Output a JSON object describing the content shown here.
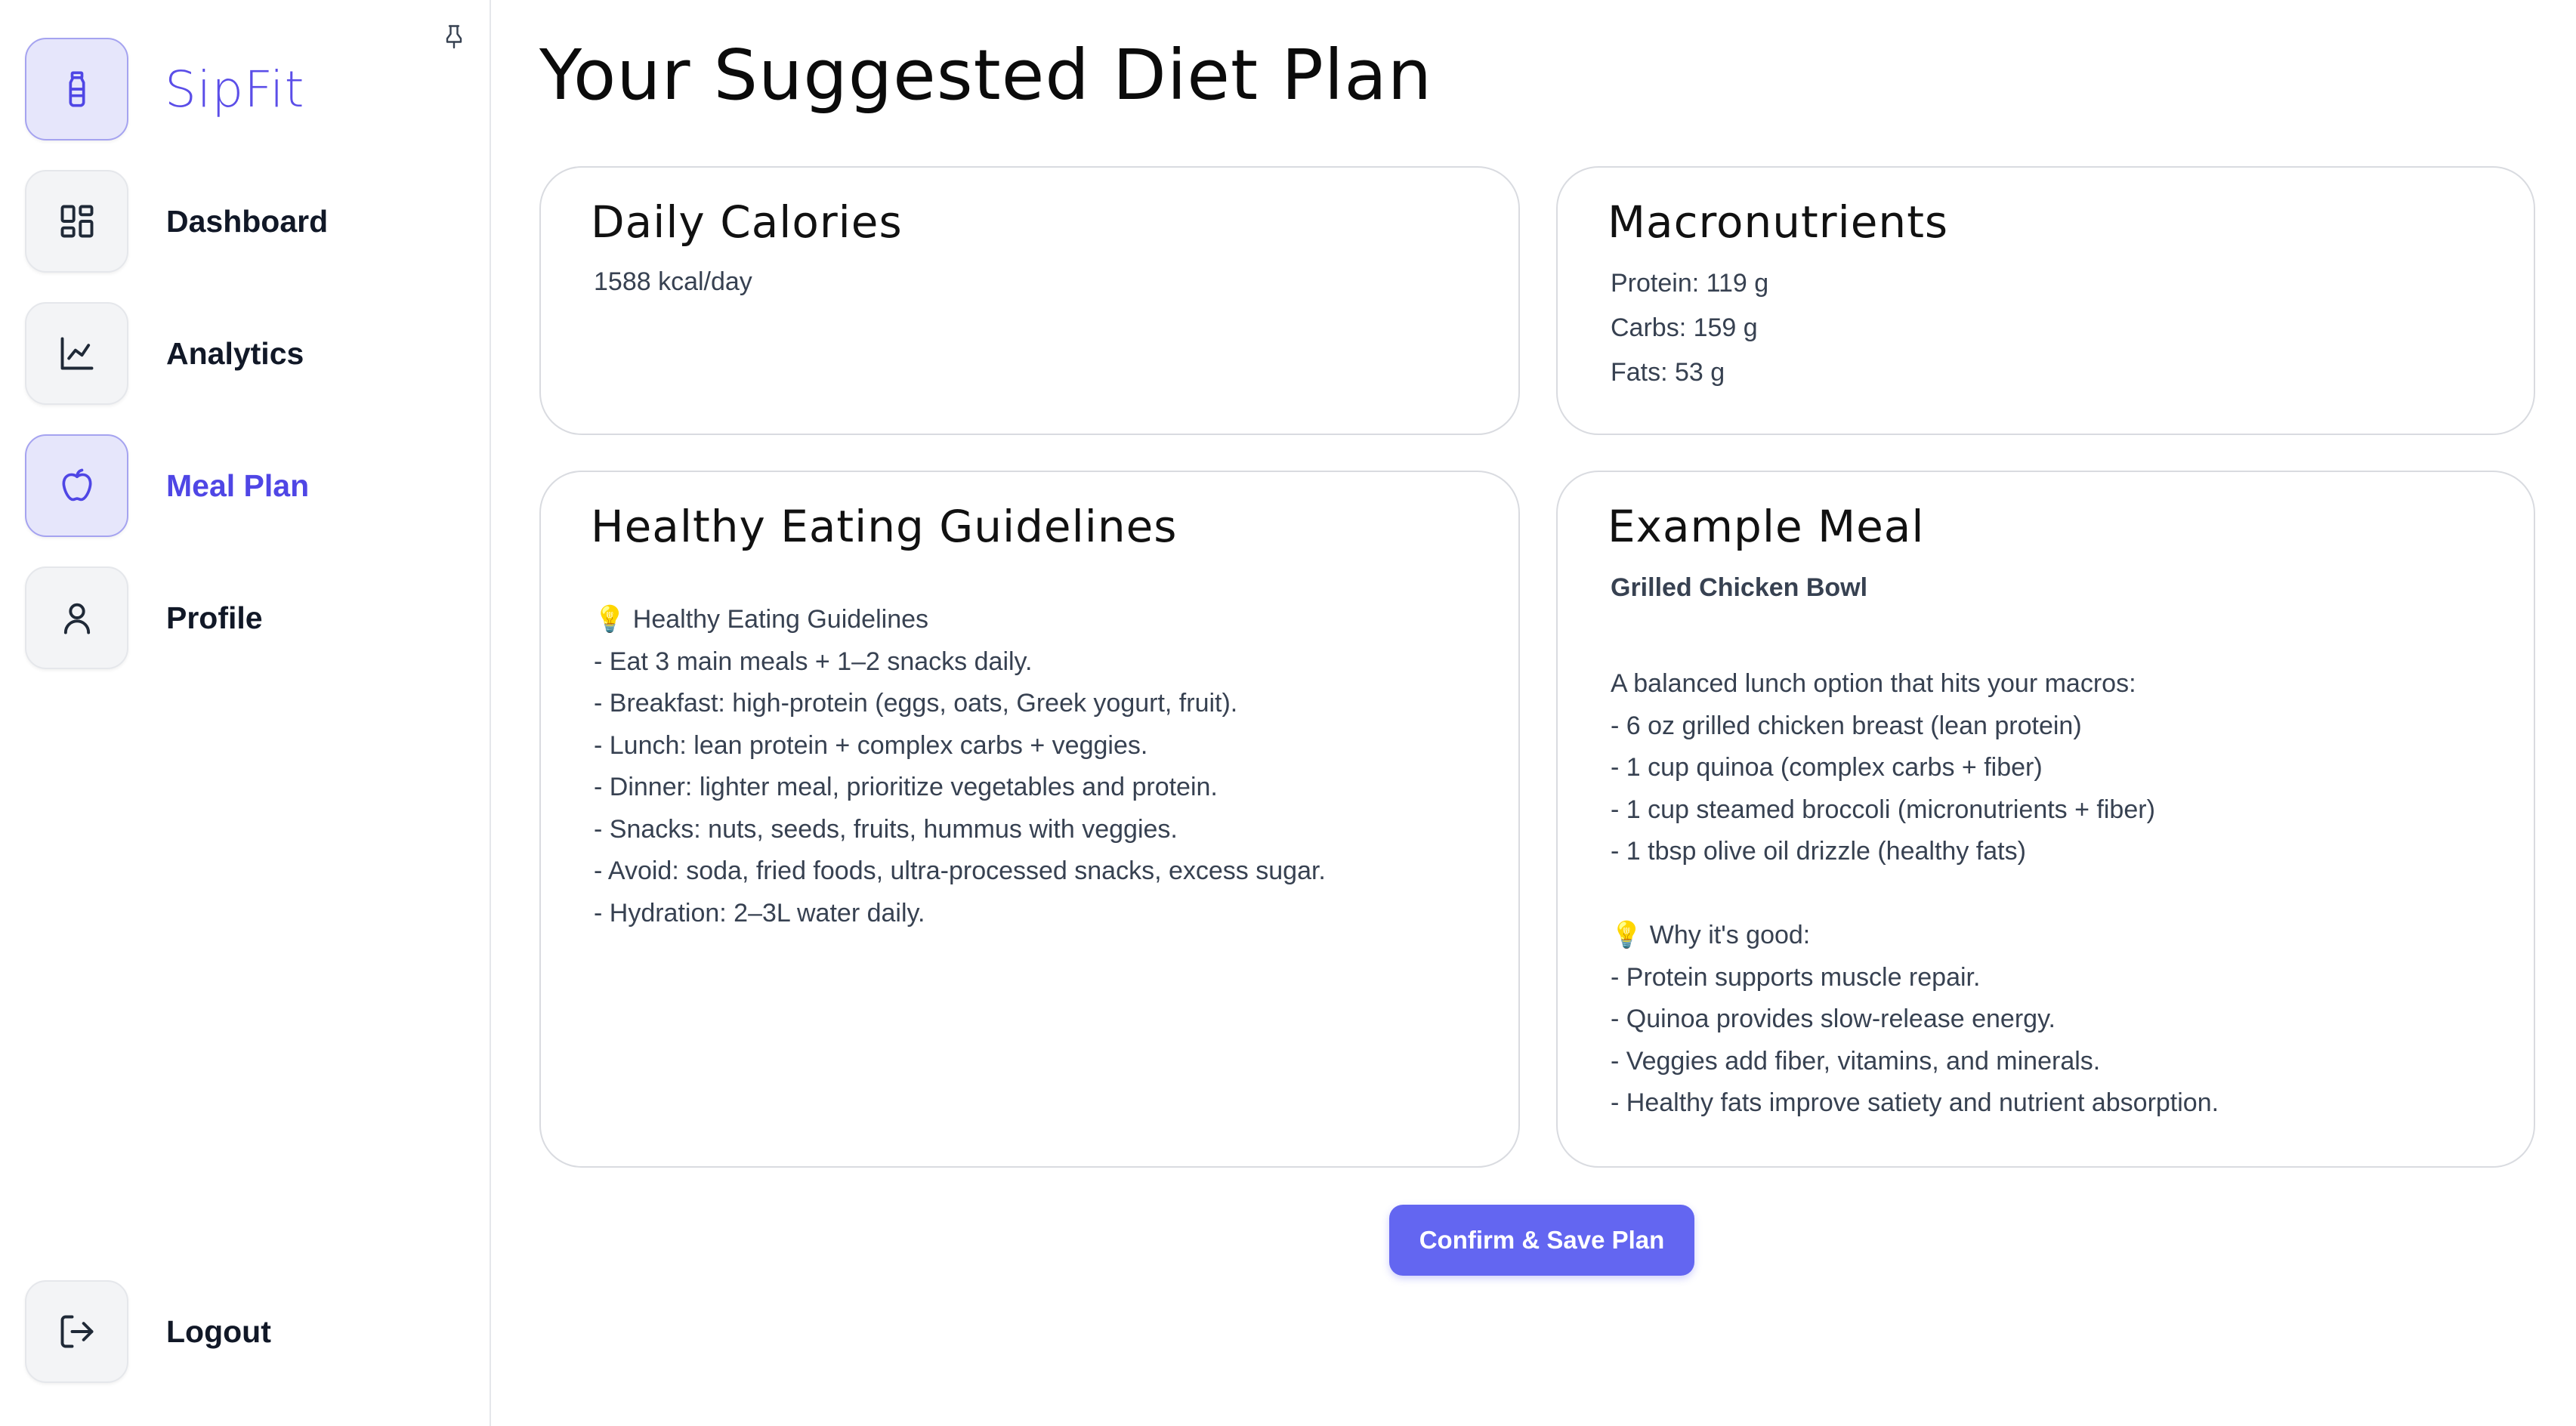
{
  "app": {
    "brand": "SipFit"
  },
  "sidebar": {
    "items": [
      {
        "label": "Dashboard",
        "icon": "dashboard-grid-icon"
      },
      {
        "label": "Analytics",
        "icon": "line-chart-icon"
      },
      {
        "label": "Meal Plan",
        "icon": "apple-icon",
        "active": true
      },
      {
        "label": "Profile",
        "icon": "user-icon"
      }
    ],
    "logout": {
      "label": "Logout",
      "icon": "logout-icon"
    }
  },
  "main": {
    "title": "Your Suggested Diet Plan",
    "calories": {
      "title": "Daily Calories",
      "value": "1588 kcal/day"
    },
    "macros": {
      "title": "Macronutrients",
      "protein": "Protein: 119 g",
      "carbs": "Carbs: 159 g",
      "fats": "Fats: 53 g"
    },
    "guidelines": {
      "title": "Healthy Eating Guidelines",
      "lines": [
        "💡 Healthy Eating Guidelines",
        "- Eat 3 main meals + 1–2 snacks daily.",
        "- Breakfast: high-protein (eggs, oats, Greek yogurt, fruit).",
        "- Lunch: lean protein + complex carbs + veggies.",
        "- Dinner: lighter meal, prioritize vegetables and protein.",
        "- Snacks: nuts, seeds, fruits, hummus with veggies.",
        "- Avoid: soda, fried foods, ultra-processed snacks, excess sugar.",
        "- Hydration: 2–3L water daily."
      ]
    },
    "example_meal": {
      "title": "Example Meal",
      "name": "Grilled Chicken Bowl",
      "lines": [
        "A balanced lunch option that hits your macros:",
        "- 6 oz grilled chicken breast (lean protein)",
        "- 1 cup quinoa (complex carbs + fiber)",
        "- 1 cup steamed broccoli (micronutrients + fiber)",
        "- 1 tbsp olive oil drizzle (healthy fats)",
        "",
        "💡 Why it's good:",
        "- Protein supports muscle repair.",
        "- Quinoa provides slow-release energy.",
        "- Veggies add fiber, vitamins, and minerals.",
        "- Healthy fats improve satiety and nutrient absorption."
      ]
    },
    "confirm_label": "Confirm & Save Plan"
  },
  "colors": {
    "accent": "#6366f1",
    "brand": "#5b4ee8",
    "active_bg": "#e6e6fb"
  }
}
